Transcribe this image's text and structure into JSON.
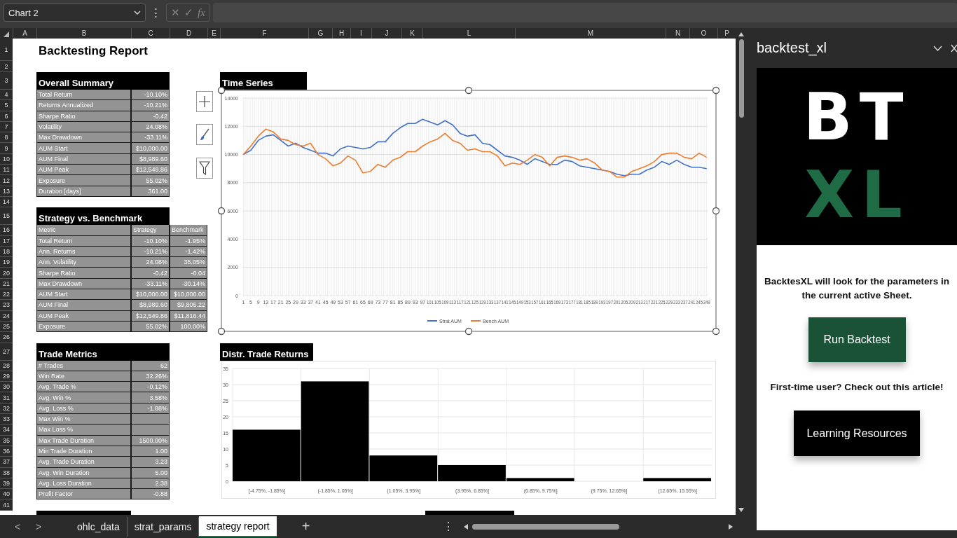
{
  "formula_bar": {
    "name_box": "Chart 2",
    "menu": "⋮",
    "buttons": [
      {
        "label": "✕",
        "disabled": true
      },
      {
        "label": "✓",
        "disabled": true
      },
      {
        "label": "fx",
        "disabled": true
      }
    ]
  },
  "column_headers": [
    "A",
    "B",
    "C",
    "D",
    "E",
    "F",
    "G",
    "H",
    "I",
    "J",
    "K",
    "L",
    "M",
    "N",
    "O",
    "P"
  ],
  "row_headers": [
    "1",
    "2",
    "3",
    "4",
    "5",
    "6",
    "7",
    "8",
    "9",
    "10",
    "11",
    "12",
    "13",
    "14",
    "15",
    "16",
    "17",
    "18",
    "19",
    "20",
    "21",
    "22",
    "23",
    "24",
    "25",
    "26",
    "27",
    "28",
    "29",
    "30",
    "31",
    "32",
    "33",
    "34",
    "35",
    "36",
    "37",
    "38",
    "39",
    "40",
    "41"
  ],
  "report_title": "Backtesting Report",
  "overall_summary": {
    "title": "Overall Summary",
    "rows": [
      {
        "label": "Total Return",
        "value": "-10.10%"
      },
      {
        "label": "Returns Annualized",
        "value": "-10.21%"
      },
      {
        "label": "Sharpe Ratio",
        "value": "-0.42"
      },
      {
        "label": "Volatility",
        "value": "24.08%"
      },
      {
        "label": "Max Drawdown",
        "value": "-33.11%"
      },
      {
        "label": "AUM Start",
        "value": "$10,000.00"
      },
      {
        "label": "AUM Final",
        "value": "$8,989.60"
      },
      {
        "label": "AUM Peak",
        "value": "$12,549.86"
      },
      {
        "label": "Exposure",
        "value": "55.02%"
      },
      {
        "label": "Duration [days]",
        "value": "361.00"
      }
    ]
  },
  "strategy_vs_benchmark": {
    "title": "Strategy vs. Benchmark",
    "header": [
      "Metric",
      "Strategy",
      "Benchmark"
    ],
    "rows": [
      {
        "label": "Total Return",
        "strategy": "-10.10%",
        "benchmark": "-1.95%"
      },
      {
        "label": "Ann. Returns",
        "strategy": "-10.21%",
        "benchmark": "-1.42%"
      },
      {
        "label": "Ann. Volatility",
        "strategy": "24.08%",
        "benchmark": "35.05%"
      },
      {
        "label": "Sharpe Ratio",
        "strategy": "-0.42",
        "benchmark": "-0.04"
      },
      {
        "label": "Max Drawdown",
        "strategy": "-33.11%",
        "benchmark": "-30.14%"
      },
      {
        "label": "AUM Start",
        "strategy": "$10,000.00",
        "benchmark": "$10,000.00"
      },
      {
        "label": "AUM Final",
        "strategy": "$8,989.60",
        "benchmark": "$9,805.22"
      },
      {
        "label": "AUM Peak",
        "strategy": "$12,549.86",
        "benchmark": "$11,816.44"
      },
      {
        "label": "Exposure",
        "strategy": "55.02%",
        "benchmark": "100.00%"
      }
    ]
  },
  "trade_metrics": {
    "title": "Trade Metrics",
    "rows": [
      {
        "label": "# Trades",
        "value": "62"
      },
      {
        "label": "Win Rate",
        "value": "32.26%"
      },
      {
        "label": "Avg. Trade %",
        "value": "-0.12%"
      },
      {
        "label": "Avg. Win %",
        "value": "3.58%"
      },
      {
        "label": "Avg. Loss %",
        "value": "-1.88%"
      },
      {
        "label": "Max Win %"
      },
      {
        "label": "Max Loss %"
      },
      {
        "label": "Max Trade Duration",
        "value": "1500.00%"
      },
      {
        "label": "Min Trade Duration",
        "value": "1.00"
      },
      {
        "label": "Avg. Trade Duration",
        "value": "3.23"
      },
      {
        "label": "Avg. Win Duration",
        "value": "5.00"
      },
      {
        "label": "Avg. Loss Duration",
        "value": "2.38"
      },
      {
        "label": "Profit Factor",
        "value": "-0.88"
      }
    ]
  },
  "charts": [
    {
      "heading": "Time Series",
      "selected": true,
      "chart_data": {
        "type": "line",
        "grid": true,
        "legend": true,
        "x": [
          1,
          5,
          9,
          13,
          17,
          21,
          25,
          29,
          33,
          37,
          41,
          45,
          49,
          53,
          57,
          61,
          65,
          69,
          73,
          77,
          81,
          85,
          89,
          93,
          97,
          101,
          105,
          109,
          113,
          117,
          121,
          125,
          129,
          133,
          137,
          141,
          145,
          149,
          153,
          157,
          161,
          165,
          169,
          173,
          177,
          181,
          185,
          189,
          193,
          197,
          201,
          205,
          209,
          213,
          217,
          221,
          225,
          229,
          233,
          237,
          241,
          245,
          249
        ],
        "xticks": [
          {
            "value": 1,
            "label": "1"
          },
          {
            "value": 5,
            "label": "5"
          },
          {
            "value": 9,
            "label": "9"
          },
          {
            "value": 13,
            "label": "13"
          },
          {
            "value": 17,
            "label": "17"
          },
          {
            "value": 21,
            "label": "21"
          },
          {
            "value": 25,
            "label": "25"
          },
          {
            "value": 29,
            "label": "29"
          },
          {
            "value": 33,
            "label": "33"
          },
          {
            "value": 37,
            "label": "37"
          },
          {
            "value": 41,
            "label": "41"
          },
          {
            "value": 45,
            "label": "45"
          },
          {
            "value": 49,
            "label": "49"
          },
          {
            "value": 53,
            "label": "53"
          },
          {
            "value": 57,
            "label": "57"
          },
          {
            "value": 61,
            "label": "61"
          },
          {
            "value": 65,
            "label": "65"
          },
          {
            "value": 69,
            "label": "69"
          },
          {
            "value": 73,
            "label": "73"
          },
          {
            "value": 77,
            "label": "77"
          },
          {
            "value": 81,
            "label": "81"
          },
          {
            "value": 85,
            "label": "85"
          },
          {
            "value": 89,
            "label": "89"
          },
          {
            "value": 93,
            "label": "93"
          },
          {
            "value": 97,
            "label": "97"
          },
          {
            "value": 101,
            "label": "101"
          },
          {
            "value": 105,
            "label": "105"
          },
          {
            "value": 109,
            "label": "109"
          },
          {
            "value": 113,
            "label": "113"
          },
          {
            "value": 117,
            "label": "117"
          },
          {
            "value": 121,
            "label": "121"
          },
          {
            "value": 125,
            "label": "125"
          },
          {
            "value": 129,
            "label": "129"
          },
          {
            "value": 133,
            "label": "133"
          },
          {
            "value": 137,
            "label": "137"
          },
          {
            "value": 141,
            "label": "141"
          },
          {
            "value": 145,
            "label": "145"
          },
          {
            "value": 149,
            "label": "149"
          },
          {
            "value": 153,
            "label": "153"
          },
          {
            "value": 157,
            "label": "157"
          },
          {
            "value": 161,
            "label": "161"
          },
          {
            "value": 165,
            "label": "165"
          },
          {
            "value": 169,
            "label": "169"
          },
          {
            "value": 173,
            "label": "173"
          },
          {
            "value": 177,
            "label": "177"
          },
          {
            "value": 181,
            "label": "181"
          },
          {
            "value": 185,
            "label": "185"
          },
          {
            "value": 189,
            "label": "189"
          },
          {
            "value": 193,
            "label": "193"
          },
          {
            "value": 197,
            "label": "197"
          },
          {
            "value": 201,
            "label": "201"
          },
          {
            "value": 205,
            "label": "205"
          },
          {
            "value": 209,
            "label": "209"
          },
          {
            "value": 213,
            "label": "213"
          },
          {
            "value": 217,
            "label": "217"
          },
          {
            "value": 221,
            "label": "221"
          },
          {
            "value": 225,
            "label": "225"
          },
          {
            "value": 229,
            "label": "229"
          },
          {
            "value": 233,
            "label": "233"
          },
          {
            "value": 237,
            "label": "237"
          },
          {
            "value": 241,
            "label": "241"
          },
          {
            "value": 245,
            "label": "245"
          },
          {
            "value": 249,
            "label": "249"
          }
        ],
        "xlim": [
          0.5,
          249.5
        ],
        "ylim": [
          0,
          14000
        ],
        "yticks": [
          {
            "value": 0,
            "label": "0"
          },
          {
            "value": 2000,
            "label": "2000"
          },
          {
            "value": 4000,
            "label": "4000"
          },
          {
            "value": 6000,
            "label": "6000"
          },
          {
            "value": 8000,
            "label": "8000"
          },
          {
            "value": 10000,
            "label": "10000"
          },
          {
            "value": 12000,
            "label": "12000"
          },
          {
            "value": 14000,
            "label": "14000"
          }
        ],
        "series": [
          {
            "name": "Strat AUM",
            "color": "#4472c4",
            "values": [
              10000,
              10300,
              11000,
              11300,
              11400,
              11000,
              10600,
              10800,
              10500,
              10300,
              10100,
              10100,
              9900,
              10400,
              10600,
              10500,
              10400,
              10500,
              10900,
              10900,
              11500,
              11900,
              12200,
              12200,
              12500,
              12300,
              12100,
              12400,
              12100,
              11500,
              11300,
              11400,
              10800,
              10700,
              10300,
              9900,
              9800,
              9600,
              9300,
              9700,
              9500,
              9300,
              9300,
              9600,
              9500,
              9200,
              9100,
              9000,
              8900,
              8800,
              8600,
              8500,
              8600,
              8600,
              8900,
              9100,
              9500,
              9300,
              9600,
              9300,
              9100,
              9100,
              9000
            ]
          },
          {
            "name": "Bench AUM",
            "color": "#ed7d31",
            "values": [
              10000,
              10600,
              11300,
              11800,
              11600,
              11100,
              11000,
              10700,
              10600,
              10800,
              10000,
              9700,
              9200,
              9400,
              9900,
              9600,
              8700,
              8800,
              9300,
              9100,
              9600,
              9800,
              10200,
              10200,
              10600,
              10900,
              11100,
              11500,
              11000,
              10800,
              10300,
              10400,
              10200,
              10200,
              9900,
              9200,
              9400,
              9300,
              9600,
              10000,
              9800,
              9200,
              9800,
              9900,
              9800,
              9600,
              9700,
              9400,
              8900,
              8800,
              8400,
              8400,
              8800,
              9000,
              9200,
              9500,
              10000,
              10100,
              10100,
              9800,
              9700,
              10100,
              9800
            ]
          }
        ]
      }
    },
    {
      "heading": "Distr. Trade Returns",
      "selected": false,
      "chart_data": {
        "type": "bar",
        "grid": true,
        "categories": [
          "[-4.75%, -1.85%]",
          "(-1.85%, 1.05%]",
          "(1.05%, 3.95%]",
          "(3.95%, 6.85%]",
          "(6.85%, 9.75%]",
          "(9.75%, 12.65%]",
          "(12.65%, 15.55%]"
        ],
        "values": [
          16,
          31,
          8,
          5,
          1,
          0,
          1
        ],
        "ylim": [
          0,
          35
        ],
        "yticks": [
          {
            "value": 0,
            "label": "0"
          },
          {
            "value": 5,
            "label": "5"
          },
          {
            "value": 10,
            "label": "10"
          },
          {
            "value": 15,
            "label": "15"
          },
          {
            "value": 20,
            "label": "20"
          },
          {
            "value": 25,
            "label": "25"
          },
          {
            "value": 30,
            "label": "30"
          },
          {
            "value": 35,
            "label": "35"
          }
        ]
      }
    }
  ],
  "sheet_tabs": {
    "nav": [
      "<",
      ">"
    ],
    "tabs": [
      {
        "label": "ohlc_data",
        "selected": false
      },
      {
        "label": "strat_params",
        "selected": false
      },
      {
        "label": "strategy report",
        "selected": true
      }
    ],
    "add": "+",
    "more": "⋮"
  },
  "task_pane": {
    "title": "backtest_xl",
    "logo": {
      "top": "BT",
      "bottom": "XL"
    },
    "message": "BacktesXL will look for the parameters in the current active Sheet.",
    "primary_button": "Run Backtest",
    "prompt": "First-time user? Check out this article!",
    "secondary_button": "Learning Resources"
  }
}
